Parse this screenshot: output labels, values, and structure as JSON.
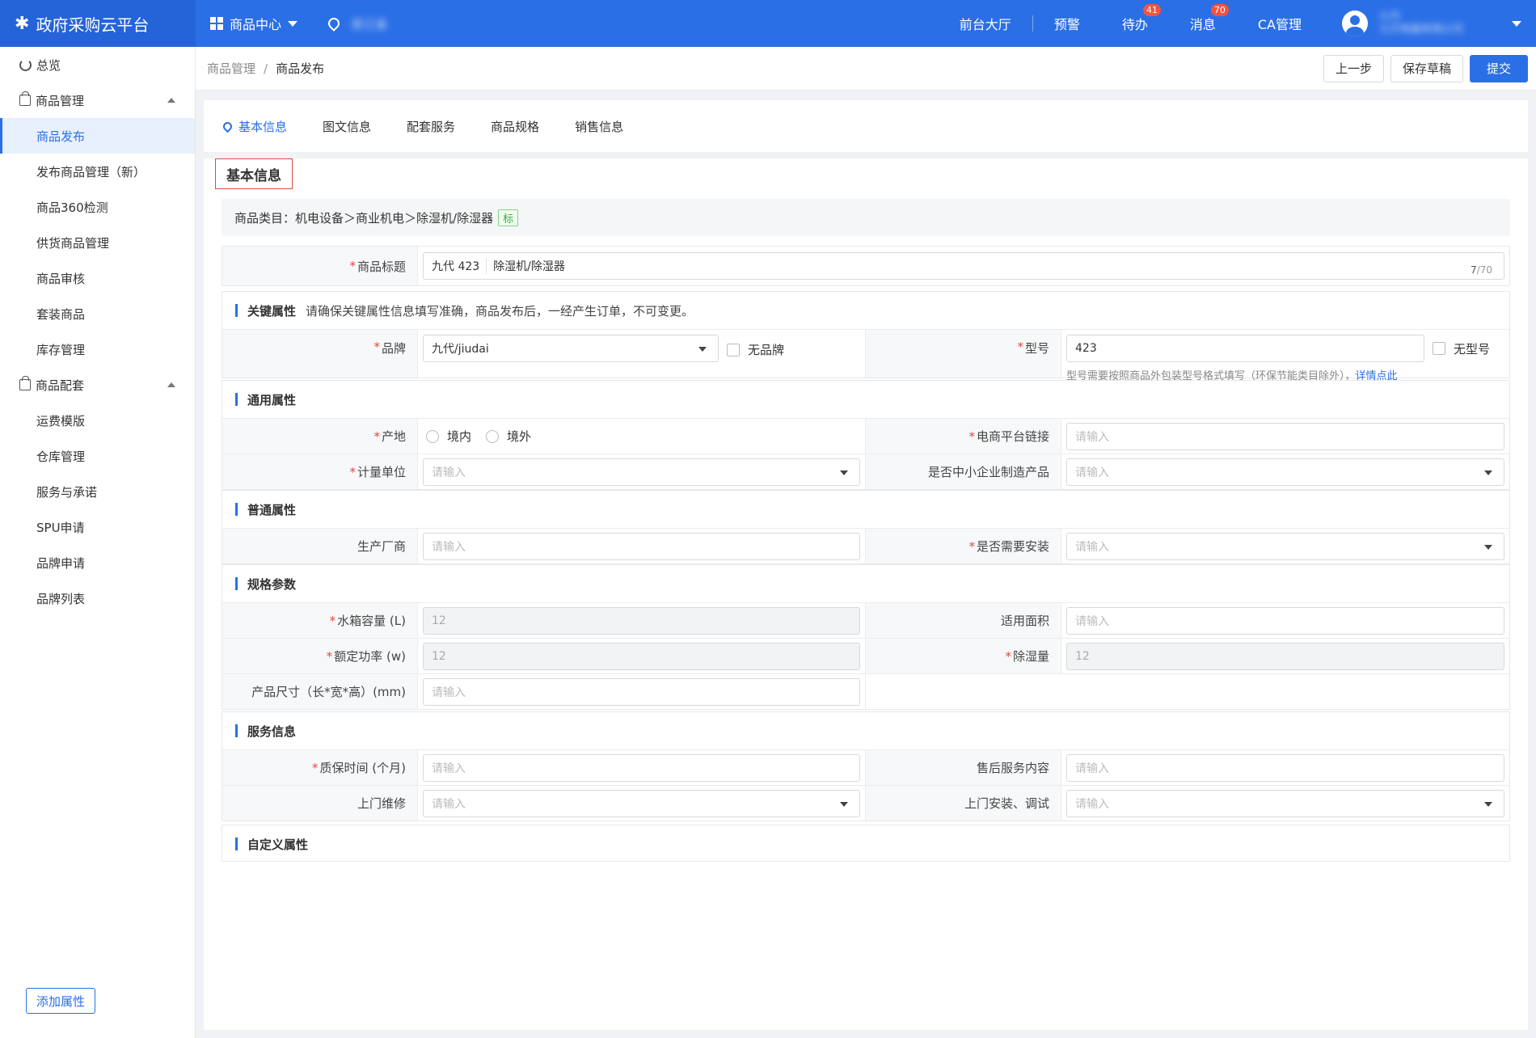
{
  "header": {
    "logo_text": "政府采购云平台",
    "menu_label": "商品中心",
    "location_text": "浙江省",
    "nav": [
      "前台大厅",
      "预警",
      "待办",
      "消息",
      "CA管理"
    ],
    "todo_badge": "41",
    "msg_badge": "70",
    "user_name": "九代",
    "user_org": "九代电器有限公司"
  },
  "sidebar": {
    "overview": "总览",
    "group1": "商品管理",
    "group1_items": [
      "商品发布",
      "发布商品管理（新）",
      "商品360检测",
      "供货商品管理",
      "商品审核",
      "套装商品",
      "库存管理"
    ],
    "group2": "商品配套",
    "group2_items": [
      "运费模版",
      "仓库管理",
      "服务与承诺",
      "SPU申请",
      "品牌申请",
      "品牌列表"
    ]
  },
  "breadcrumb": {
    "parent": "商品管理",
    "sep": "/",
    "current": "商品发布"
  },
  "actions": {
    "prev": "上一步",
    "draft": "保存草稿",
    "submit": "提交"
  },
  "tabs": [
    "基本信息",
    "图文信息",
    "配套服务",
    "商品规格",
    "销售信息"
  ],
  "section_title": "基本信息",
  "category": {
    "label": "商品类目：",
    "path": "机电设备＞商业机电＞除湿机/除湿器",
    "tag": "标"
  },
  "title_field": {
    "label": "商品标题",
    "prefix": "九代 423",
    "value": "除湿机/除湿器",
    "count": "7",
    "max": "/70"
  },
  "key_attrs": {
    "title": "关键属性",
    "hint": "请确保关键属性信息填写准确，商品发布后，一经产生订单，不可变更。",
    "brand_label": "品牌",
    "brand_value": "九代/jiudai",
    "no_brand": "无品牌",
    "model_label": "型号",
    "model_value": "423",
    "no_model": "无型号",
    "model_help": "型号需要按照商品外包装型号格式填写（环保节能类目除外），",
    "model_help_link": "详情点此"
  },
  "general_attrs": {
    "title": "通用属性",
    "origin_label": "产地",
    "origin_opts": [
      "境内",
      "境外"
    ],
    "ecom_label": "电商平台链接",
    "unit_label": "计量单位",
    "sme_label": "是否中小企业制造产品"
  },
  "common_attrs": {
    "title": "普通属性",
    "maker_label": "生产厂商",
    "install_label": "是否需要安装"
  },
  "spec": {
    "title": "规格参数",
    "tank_label": "水箱容量 (L)",
    "tank_value": "12",
    "area_label": "适用面积",
    "power_label": "额定功率 (w)",
    "power_value": "12",
    "dehum_label": "除湿量",
    "dehum_value": "12",
    "size_label": "产品尺寸（长*宽*高）(mm)"
  },
  "service": {
    "title": "服务信息",
    "warranty_label": "质保时间 (个月)",
    "after_label": "售后服务内容",
    "repair_label": "上门维修",
    "install_label": "上门安装、调试"
  },
  "custom": {
    "title": "自定义属性",
    "add_btn": "添加属性"
  },
  "placeholder": "请输入",
  "required_mark": "*"
}
